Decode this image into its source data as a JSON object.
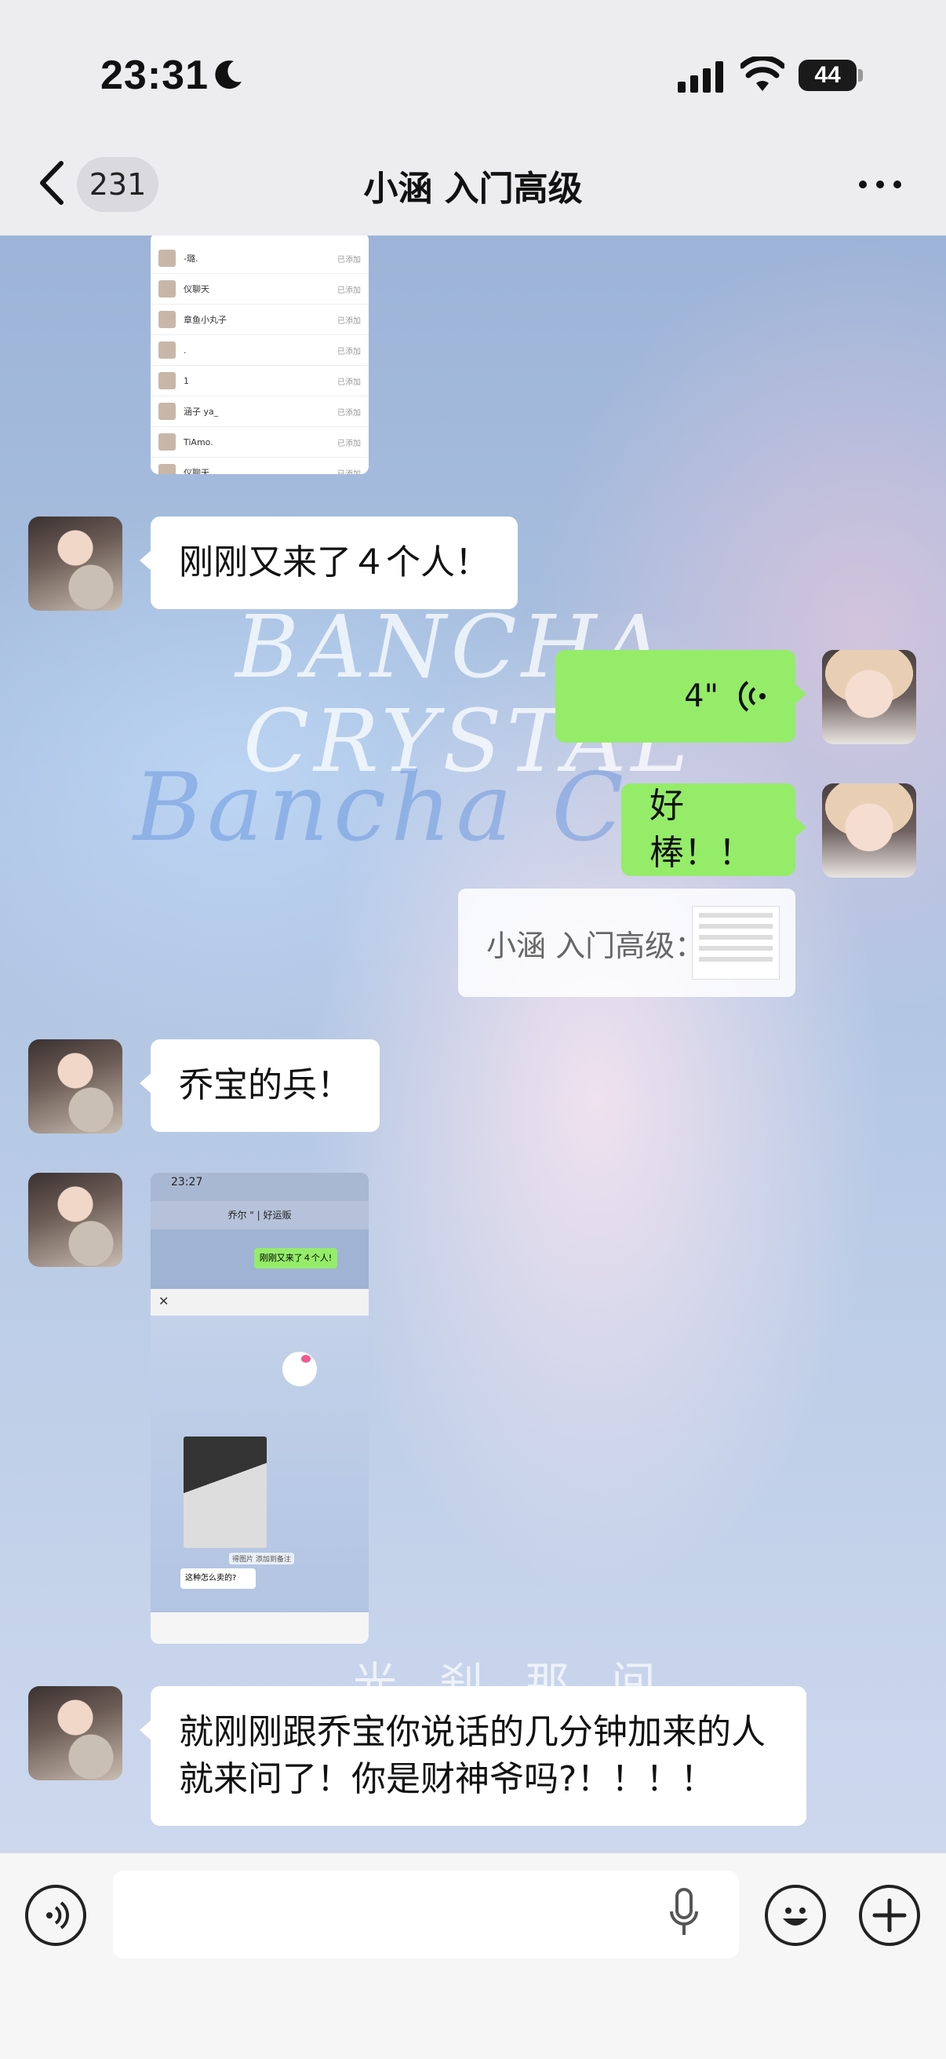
{
  "status_bar": {
    "time": "23:31",
    "battery": "44"
  },
  "nav": {
    "unread_count": "231",
    "title": "小涵 入门高级"
  },
  "background": {
    "line1": "BANCHA",
    "line2": "CRYSTAL",
    "line3": "Bancha C",
    "line4": "光 刹 那 间"
  },
  "thumb1": {
    "rows": [
      {
        "name": "-璐.",
        "status": "已添加"
      },
      {
        "name": "仪聊天",
        "status": "已添加"
      },
      {
        "name": "章鱼小丸子",
        "status": "已添加"
      },
      {
        "name": ".",
        "status": "已添加"
      },
      {
        "name": "1",
        "status": "已添加"
      },
      {
        "name": "涵子 ya_",
        "status": "已添加"
      },
      {
        "name": "TiAmo.",
        "status": "已添加"
      },
      {
        "name": "仪聊天",
        "status": "已添加"
      }
    ]
  },
  "messages": {
    "m1": "刚刚又来了４个人！",
    "m2_voice": "4\"",
    "m3": "好棒！！",
    "m4_quote": "小涵 入门高级：",
    "m5": "乔宝的兵！",
    "m6_screenshot": {
      "time": "23:27",
      "title": "乔尔 \" | 好运贩",
      "msg": "刚刚又来了４个人!",
      "msg2": "这种怎么卖的?",
      "badge": "得图片 添加到备注"
    },
    "m7": "就刚刚跟乔宝你说话的几分钟加来的人就来问了！你是财神爷吗?！！！！"
  },
  "colors": {
    "green_bubble": "#95ec69",
    "white_bubble": "#ffffff"
  }
}
